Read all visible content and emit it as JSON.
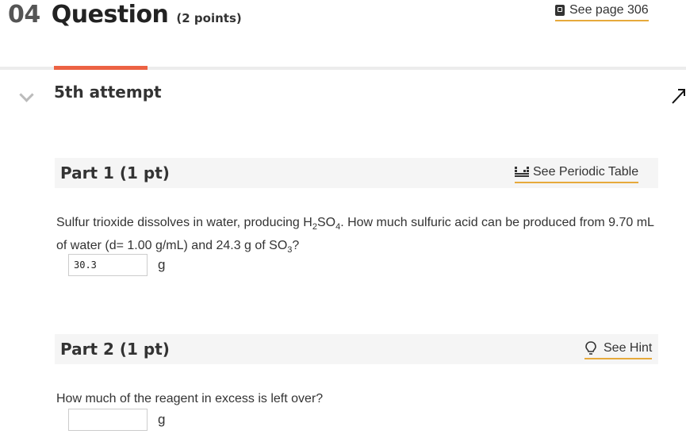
{
  "question": {
    "number": "04",
    "title": "Question",
    "points": "(2 points)",
    "see_page": "See page 306"
  },
  "attempt": {
    "label": "5th attempt"
  },
  "part1": {
    "title": "Part 1 (1 pt)",
    "link": "See Periodic Table",
    "text_a": "Sulfur trioxide dissolves in water, producing H",
    "text_a_sub": "2",
    "text_b": "SO",
    "text_b_sub": "4",
    "text_c": ". How much sulfuric acid can be produced from 9.70 mL of water (d= 1.00 g/mL) and 24.3 g of SO",
    "text_c_sub": "3",
    "text_d": "?",
    "answer_value": "30.3",
    "unit": "g"
  },
  "part2": {
    "title": "Part 2 (1 pt)",
    "link": "See Hint",
    "text": "How much of the reagent in excess is left over?",
    "answer_value": "",
    "unit": "g"
  },
  "colors": {
    "accent_tab": "#ec6243",
    "link_underline": "#e6a93b"
  },
  "icons": [
    "book-icon",
    "chevron-down-icon",
    "collapse-arrow-icon",
    "periodic-table-icon",
    "lightbulb-icon"
  ]
}
